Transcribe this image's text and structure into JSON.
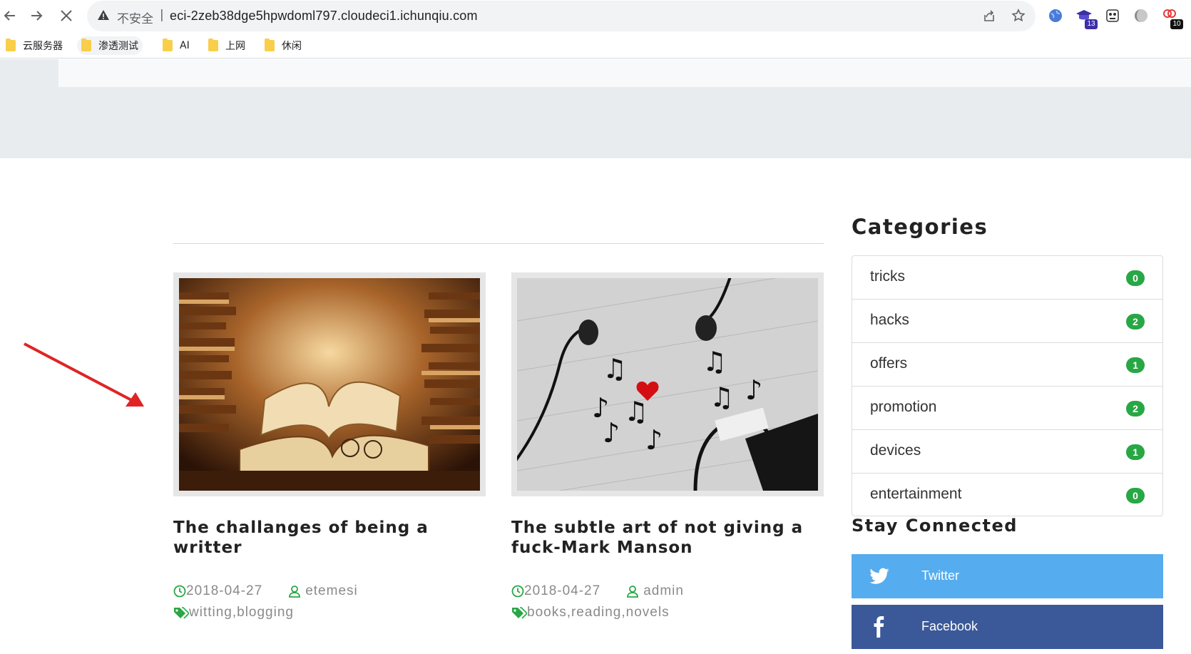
{
  "browser": {
    "security_label": "不安全",
    "url": "eci-2zeb38dge5hpwdoml797.cloudeci1.ichunqiu.com",
    "extension_badges": [
      "13",
      "10"
    ],
    "bookmarks": [
      {
        "label": "云服务器"
      },
      {
        "label": "渗透测试"
      },
      {
        "label": "AI"
      },
      {
        "label": "上网"
      },
      {
        "label": "休闲"
      }
    ]
  },
  "posts": [
    {
      "title": "The challanges of being a writter",
      "date": "2018-04-27",
      "author": "etemesi",
      "tags": "witting,blogging",
      "image": "stacked-books-image"
    },
    {
      "title": "The subtle art of not giving a fuck-Mark Manson",
      "date": "2018-04-27",
      "author": "admin",
      "tags": "books,reading,novels",
      "image": "earphones-music-notes-image"
    }
  ],
  "sidebar": {
    "categories_heading": "Categories",
    "categories": [
      {
        "name": "tricks",
        "count": "0"
      },
      {
        "name": "hacks",
        "count": "2"
      },
      {
        "name": "offers",
        "count": "1"
      },
      {
        "name": "promotion",
        "count": "2"
      },
      {
        "name": "devices",
        "count": "1"
      },
      {
        "name": "entertainment",
        "count": "0"
      }
    ],
    "stay_connected_heading": "Stay Connected",
    "social": [
      {
        "label": "Twitter",
        "color": "#55acee"
      },
      {
        "label": "Facebook",
        "color": "#3b5998"
      }
    ]
  },
  "colors": {
    "accent_green": "#28a745",
    "annotation_arrow": "#e02424"
  }
}
